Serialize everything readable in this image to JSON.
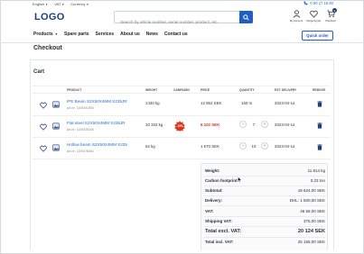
{
  "topbar": {
    "language": "English",
    "vat": "VAT",
    "currency": "Currency",
    "phone": "0 90 17 15 60"
  },
  "header": {
    "logo": "LOGO",
    "search_placeholder": "Search by article number, serial number, product, etc.",
    "icons": [
      {
        "name": "my-account-icon",
        "label": "My Account"
      },
      {
        "name": "shopping-list-icon",
        "label": "Shopping list"
      },
      {
        "name": "cart-icon",
        "label": "Checkout",
        "badge": "3"
      }
    ]
  },
  "nav": {
    "items": [
      "Products",
      "Spare parts",
      "Services",
      "About us",
      "News",
      "Contact us"
    ],
    "quick_order": "Quick order"
  },
  "page": {
    "title": "Checkout",
    "cart_title": "Cart"
  },
  "table": {
    "headers": [
      "PRODUCT",
      "WEIGHT",
      "CAMPAIGN",
      "PRICE",
      "QUANTITY",
      "EST. DELIVERY",
      "REMOVE"
    ],
    "rows": [
      {
        "name": "IPE Beam S2X50X4MM S235JR",
        "art": "Art.nr: 1100401800",
        "weight": "1430 kg",
        "price": "12 952 SEK",
        "quantity": "160 m",
        "delivery": "2023-04-14"
      },
      {
        "name": "Flat steel S2X50X4MM S235JR",
        "art": "Art.nr: 1100025345",
        "weight": "10 332 kg",
        "campaign": "-15%",
        "price": "6 102 SEK",
        "quantity": "7",
        "delivery": "2023-04-14"
      },
      {
        "name": "Hollow beam S2X50X4MM S235",
        "art": "Art.nr: 1100478402",
        "weight": "52 kg",
        "price": "1 570 SEK",
        "quantity": "10",
        "delivery": "2023-04-14"
      }
    ]
  },
  "summary": {
    "weight_label": "Weight:",
    "weight": "11 814 kg",
    "carbon_label": "Carbon footprint:",
    "carbon": "0,23 ton",
    "subtotal_label": "Subtotal:",
    "subtotal": "18 624,00 SEK",
    "delivery_label": "Delivery:",
    "delivery": "DHL: 1 500,00 SEK",
    "vat_label": "VAT:",
    "vat": "46 56,00 SEK",
    "shipping_vat_label": "Shipping VAT:",
    "shipping_vat": "375,00 SEK",
    "total_excl_label": "Total excl. VAT:",
    "total_excl": "20 124 SEK",
    "total_incl_label": "Total incl. VAT:",
    "total_incl": "25 155,00 SEK"
  },
  "colors": {
    "primary": "#1f5fbf",
    "brand": "#18407e",
    "sale": "#d9361f",
    "link": "#1e6fd0"
  }
}
